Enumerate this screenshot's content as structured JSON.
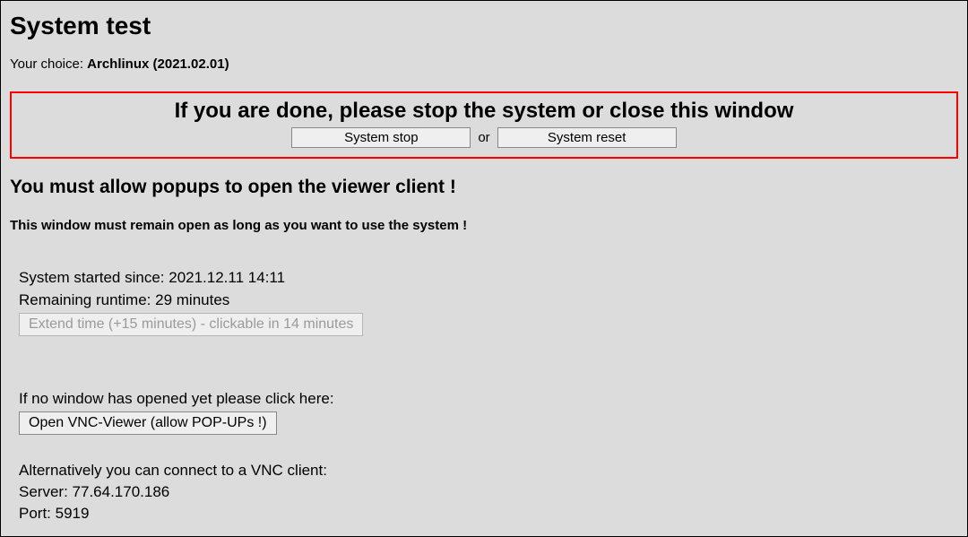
{
  "title": "System test",
  "choice": {
    "label_prefix": "Your choice: ",
    "value": "Archlinux (2021.02.01)"
  },
  "done_box": {
    "headline": "If you are done, please stop the system or close this window",
    "stop_label": "System stop",
    "or_label": "or",
    "reset_label": "System reset"
  },
  "popup_warning": "You must allow popups to open the viewer client !",
  "remain_open_notice": "This window must remain open as long as you want to use the system !",
  "status": {
    "started_label": "System started since: ",
    "started_value": "2021.12.11 14:11",
    "remaining_label": "Remaining runtime: ",
    "remaining_value": "29 minutes",
    "extend_label": "Extend time (+15 minutes) - clickable in 14 minutes"
  },
  "vnc": {
    "hint": "If no window has opened yet please click here:",
    "open_label": "Open VNC-Viewer (allow POP-UPs !)"
  },
  "connection": {
    "alt_text": "Alternatively you can connect to a VNC client:",
    "server_label": "Server: ",
    "server_value": "77.64.170.186",
    "port_label": "Port: ",
    "port_value": "5919"
  }
}
